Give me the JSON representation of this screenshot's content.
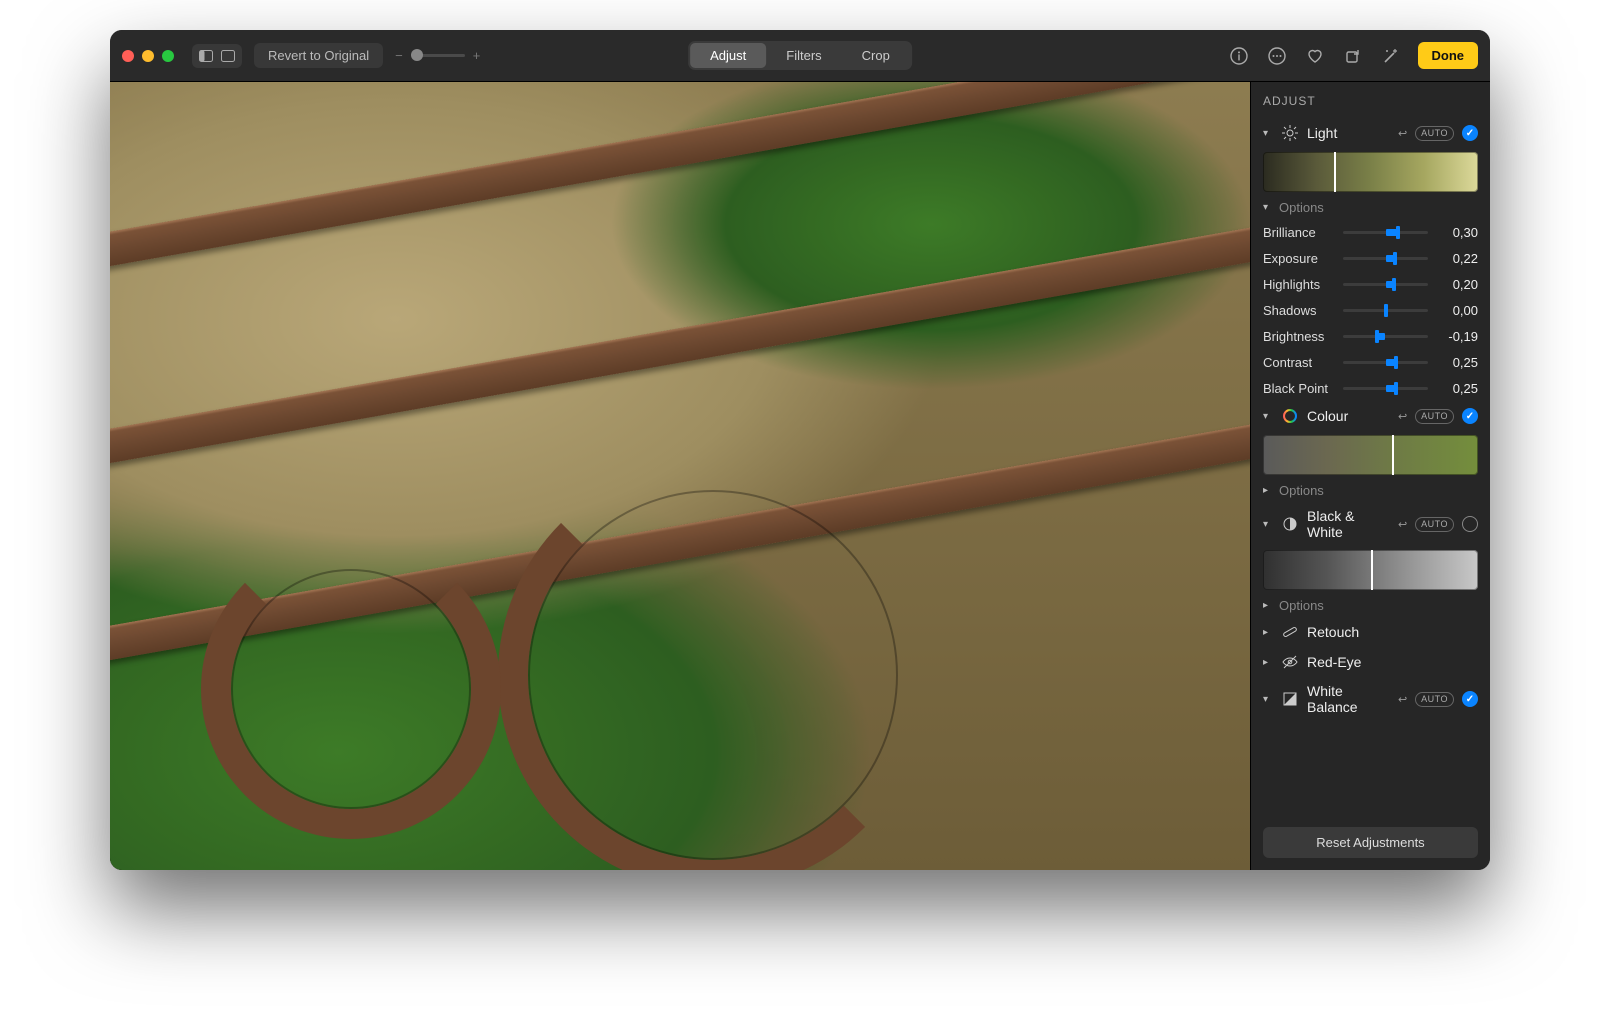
{
  "accent": "#0a84ff",
  "toolbar": {
    "revert_label": "Revert to Original",
    "tabs": [
      "Adjust",
      "Filters",
      "Crop"
    ],
    "active_tab": 0,
    "done_label": "Done"
  },
  "sidebar": {
    "title": "ADJUST",
    "auto_label": "AUTO",
    "reset_label": "Reset Adjustments",
    "options_label": "Options",
    "light": {
      "title": "Light",
      "expanded": true,
      "options_expanded": true,
      "strip_cursor": 0.33,
      "params": [
        {
          "label": "Brilliance",
          "value": "0,30",
          "num": 0.3
        },
        {
          "label": "Exposure",
          "value": "0,22",
          "num": 0.22
        },
        {
          "label": "Highlights",
          "value": "0,20",
          "num": 0.2
        },
        {
          "label": "Shadows",
          "value": "0,00",
          "num": 0.0
        },
        {
          "label": "Brightness",
          "value": "-0,19",
          "num": -0.19
        },
        {
          "label": "Contrast",
          "value": "0,25",
          "num": 0.25
        },
        {
          "label": "Black Point",
          "value": "0,25",
          "num": 0.25
        }
      ]
    },
    "colour": {
      "title": "Colour",
      "expanded": true,
      "options_expanded": false,
      "strip_cursor": 0.6
    },
    "bw": {
      "title": "Black & White",
      "expanded": true,
      "options_expanded": false,
      "strip_cursor": 0.5
    },
    "retouch_title": "Retouch",
    "redeye_title": "Red-Eye",
    "wb_title": "White Balance"
  }
}
